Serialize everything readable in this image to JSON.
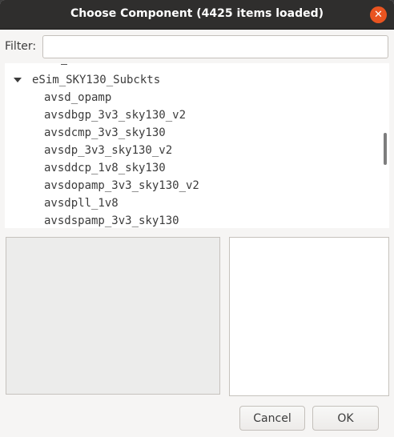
{
  "window": {
    "title": "Choose Component (4425 items loaded)",
    "close_glyph": "✕"
  },
  "filter": {
    "label": "Filter:",
    "value": "",
    "placeholder": ""
  },
  "tree": {
    "group": {
      "label": "eSim_SKY130_Subckts",
      "expanded": true
    },
    "items": [
      "avsd_opamp",
      "avsdbgp_3v3_sky130_v2",
      "avsdcmp_3v3_sky130",
      "avsdp_3v3_sky130_v2",
      "avsddcp_1v8_sky130",
      "avsdopamp_3v3_sky130_v2",
      "avsdpll_1v8",
      "avsdspamp_3v3_sky130"
    ]
  },
  "buttons": {
    "cancel": "Cancel",
    "ok": "OK"
  },
  "colors": {
    "titlebar": "#2f2e2d",
    "close_button": "#e95420",
    "dialog_bg": "#f6f5f4"
  },
  "icons": [
    "close-icon",
    "expander-triangle-icon"
  ]
}
